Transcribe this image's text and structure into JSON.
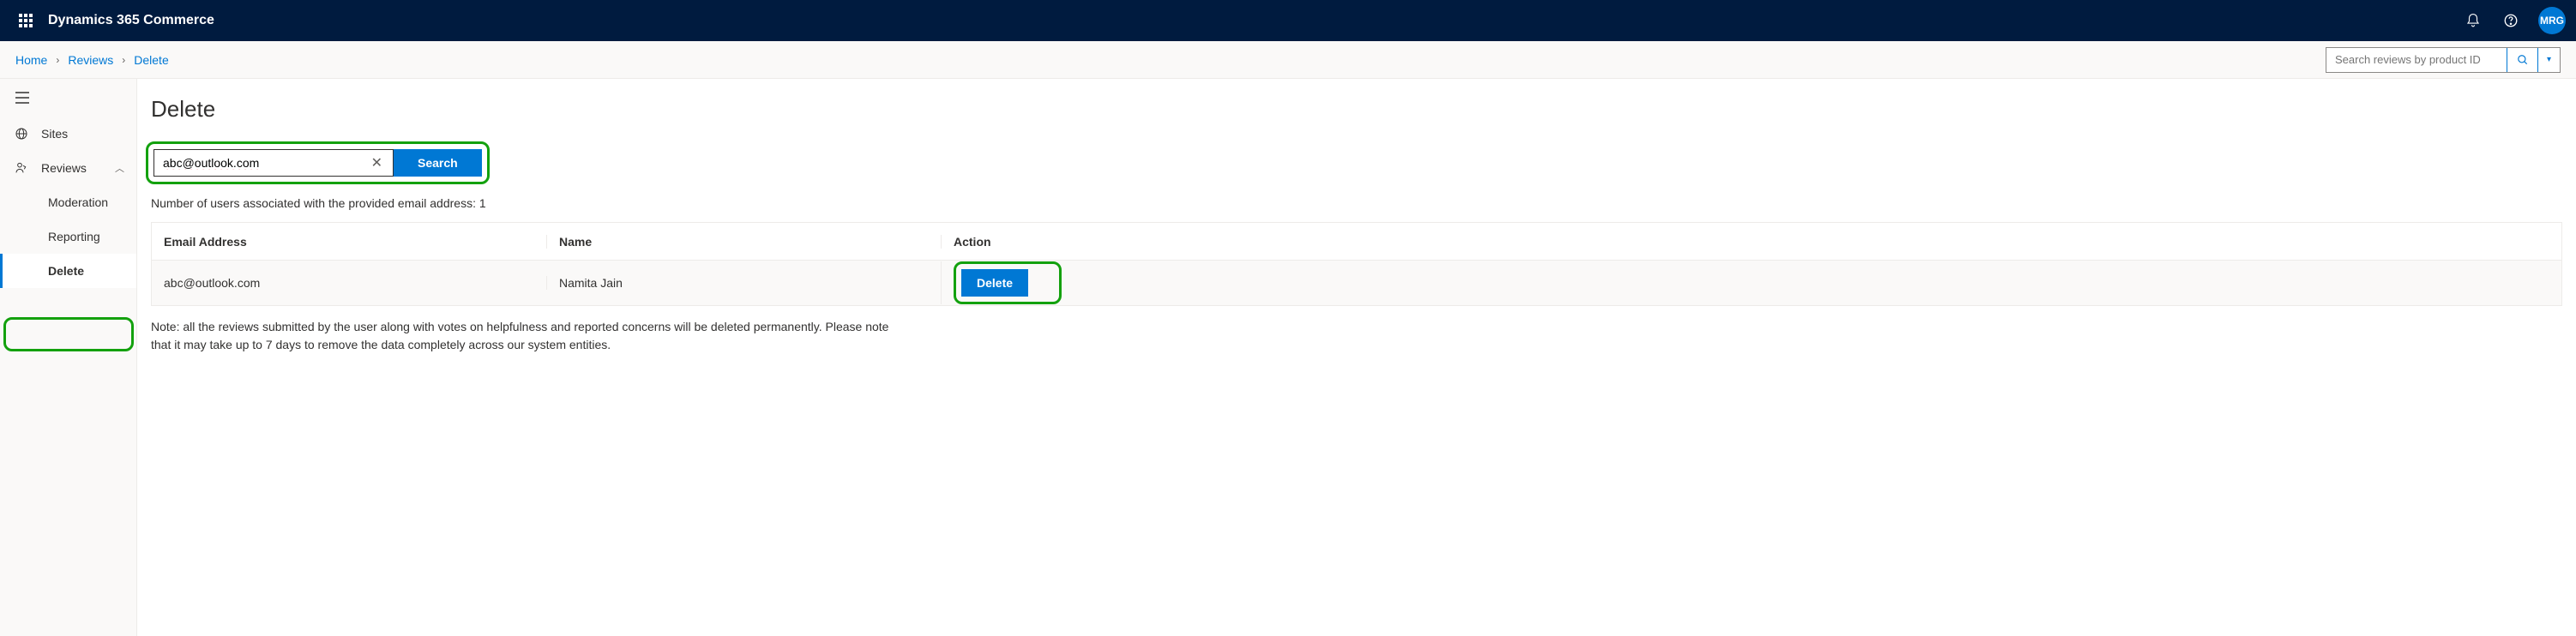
{
  "header": {
    "app_title": "Dynamics 365 Commerce",
    "avatar_initials": "MRG"
  },
  "breadcrumb": {
    "items": [
      "Home",
      "Reviews",
      "Delete"
    ]
  },
  "top_search": {
    "placeholder": "Search reviews by product ID"
  },
  "sidebar": {
    "items": [
      {
        "label": "Sites"
      },
      {
        "label": "Reviews"
      },
      {
        "label": "Moderation"
      },
      {
        "label": "Reporting"
      },
      {
        "label": "Delete"
      }
    ]
  },
  "page": {
    "title": "Delete",
    "email_value": "abc@outlook.com",
    "search_button": "Search",
    "result_count_label": "Number of users associated with the provided email address: 1"
  },
  "table": {
    "headers": {
      "email": "Email Address",
      "name": "Name",
      "action": "Action"
    },
    "rows": [
      {
        "email": "abc@outlook.com",
        "name": "Namita Jain",
        "action_label": "Delete"
      }
    ]
  },
  "note": "Note: all the reviews submitted by the user along with votes on helpfulness and reported concerns will be deleted permanently. Please note that it may take up to 7 days to remove the data completely across our system entities."
}
